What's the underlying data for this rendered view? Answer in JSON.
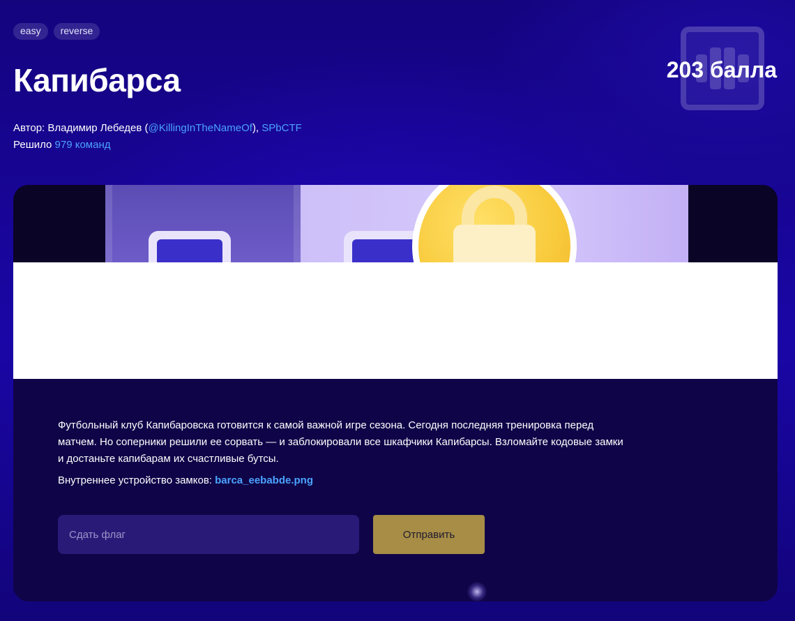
{
  "tags": [
    "easy",
    "reverse"
  ],
  "title": "Капибарса",
  "points": "203 балла",
  "meta": {
    "author_prefix": "Автор: Владимир Лебедев (",
    "author_handle": "@KillingInTheNameOf",
    "author_sep": "), ",
    "author_team": "SPbCTF",
    "solved_prefix": "Решило ",
    "solved_count": "979 команд"
  },
  "description": {
    "line1": "Футбольный клуб Капибаровска готовится к самой важной игре сезона. Сегодня последняя тренировка перед матчем. Но соперники решили ее сорвать — и заблокировали все шкафчики Капибарсы. Взломайте кодовые замки и достаньте капибарам их счастливые бутсы.",
    "attachment_prefix": "Внутреннее устройство замков: ",
    "attachment_file": "barca_eebabde.png"
  },
  "flag_form": {
    "placeholder": "Сдать флаг",
    "submit_label": "Отправить"
  },
  "colors": {
    "accent_link": "#4ba3ff",
    "submit_bg": "#a78d45",
    "page_bg": "#1a06a6"
  },
  "icons": {
    "points_bg": "dumbbell-icon",
    "banner": "padlock-icon"
  }
}
